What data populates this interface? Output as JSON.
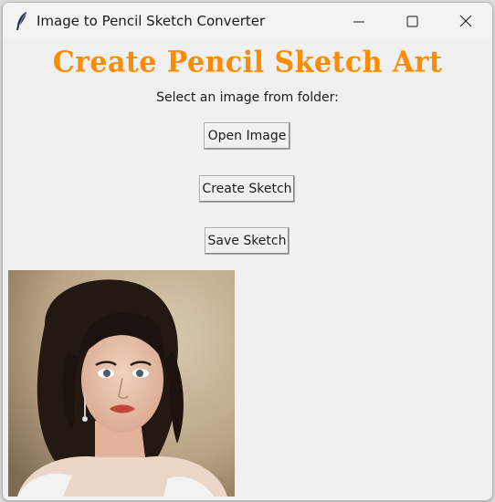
{
  "window": {
    "title": "Image to Pencil Sketch Converter",
    "icon": "feather-icon",
    "controls": [
      "minimize-icon",
      "maximize-icon",
      "close-icon"
    ]
  },
  "main": {
    "heading": "Create Pencil Sketch Art",
    "prompt": "Select an image from folder:",
    "buttons": {
      "open": "Open Image",
      "create": "Create Sketch",
      "save": "Save Sketch"
    },
    "image": "portrait-photo"
  },
  "colors": {
    "heading": "#ff8c00",
    "background": "#f0f0f0"
  }
}
